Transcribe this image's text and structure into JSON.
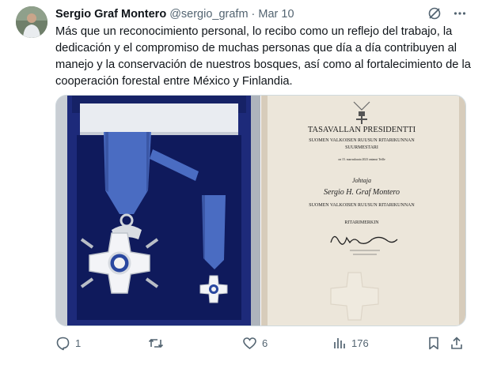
{
  "author": {
    "name": "Sergio Graf Montero",
    "handle": "@sergio_grafm",
    "separator": "·",
    "date": "Mar 10"
  },
  "tweet_text": "Más que un reconocimiento personal, lo recibo como un reflejo del trabajo, la dedicación y el compromiso de muchas personas que día a día contribuyen al manejo y la conservación de nuestros bosques, así como al fortalecimiento de la cooperación forestal entre México y Finlandia.",
  "certificate": {
    "heading": "TASAVALLAN PRESIDENTTI",
    "order_line1": "SUOMEN VALKOISEN RUUSUN RITARIKUNNAN",
    "order_line2": "SUURMESTARI",
    "date_line": "on 15. marraskuuta 2023 antanut Teille",
    "recipient_prefix": "Johtaja",
    "recipient": "Sergio H. Graf Montero",
    "order_line3": "SUOMEN VALKOISEN RUUSUN RITARIKUNNAN",
    "rank": "RITARIMERKIN"
  },
  "actions": {
    "replies": "1",
    "retweets": "",
    "likes": "6",
    "views": "176"
  },
  "colors": {
    "text": "#0f1419",
    "secondary": "#536471",
    "border": "#cfd9de",
    "ribbon": "#4a6cc2",
    "box": "#1d2a7a"
  }
}
